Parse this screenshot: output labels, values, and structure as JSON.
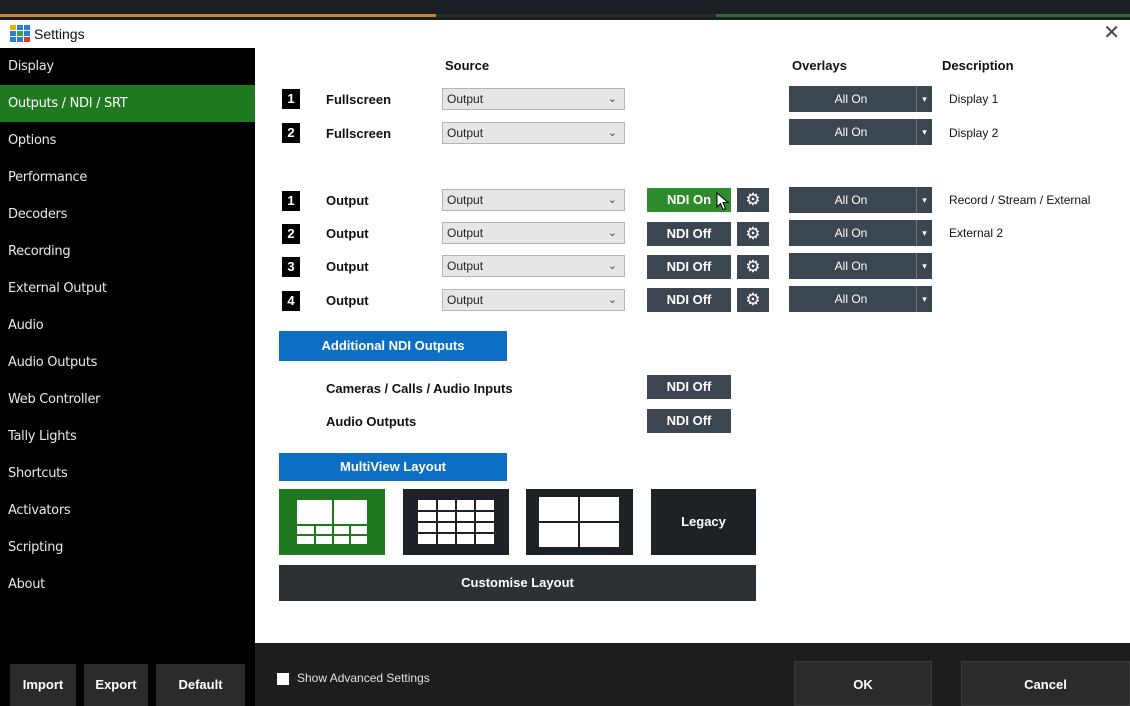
{
  "window": {
    "title": "Settings",
    "close_glyph": "✕"
  },
  "sidebar": {
    "items": [
      {
        "label": "Display"
      },
      {
        "label": "Outputs / NDI / SRT",
        "active": true
      },
      {
        "label": "Options"
      },
      {
        "label": "Performance"
      },
      {
        "label": "Decoders"
      },
      {
        "label": "Recording"
      },
      {
        "label": "External Output"
      },
      {
        "label": "Audio"
      },
      {
        "label": "Audio Outputs"
      },
      {
        "label": "Web Controller"
      },
      {
        "label": "Tally Lights"
      },
      {
        "label": "Shortcuts"
      },
      {
        "label": "Activators"
      },
      {
        "label": "Scripting"
      },
      {
        "label": "About"
      }
    ],
    "buttons": {
      "import": "Import",
      "export": "Export",
      "default": "Default"
    }
  },
  "headers": {
    "source": "Source",
    "overlays": "Overlays",
    "description": "Description"
  },
  "fullscreen_rows": [
    {
      "num": "1",
      "label": "Fullscreen",
      "source": "Output",
      "overlay": "All On",
      "description": "Display 1"
    },
    {
      "num": "2",
      "label": "Fullscreen",
      "source": "Output",
      "overlay": "All On",
      "description": "Display 2"
    }
  ],
  "output_rows": [
    {
      "num": "1",
      "label": "Output",
      "source": "Output",
      "ndi": "NDI On",
      "overlay": "All On",
      "description": "Record / Stream / External"
    },
    {
      "num": "2",
      "label": "Output",
      "source": "Output",
      "ndi": "NDI Off",
      "overlay": "All On",
      "description": "External 2"
    },
    {
      "num": "3",
      "label": "Output",
      "source": "Output",
      "ndi": "NDI Off",
      "overlay": "All On",
      "description": ""
    },
    {
      "num": "4",
      "label": "Output",
      "source": "Output",
      "ndi": "NDI Off",
      "overlay": "All On",
      "description": ""
    }
  ],
  "additional": {
    "button": "Additional NDI Outputs",
    "rows": [
      {
        "label": "Cameras / Calls / Audio Inputs",
        "ndi": "NDI Off"
      },
      {
        "label": "Audio Outputs",
        "ndi": "NDI Off"
      }
    ]
  },
  "multiview": {
    "button": "MultiView Layout",
    "legacy": "Legacy",
    "customise": "Customise Layout"
  },
  "footer": {
    "show_advanced": "Show Advanced Settings",
    "ok": "OK",
    "cancel": "Cancel"
  },
  "colors": {
    "accent_green": "#1f7a1f",
    "ndi_on": "#2e8b2e",
    "blue": "#0d6fc4",
    "slate": "#3c4650"
  },
  "icons": {
    "chevron": "chevron-down-icon",
    "gear": "gear-icon",
    "overlay_arrow": "dropdown-arrow-icon"
  }
}
